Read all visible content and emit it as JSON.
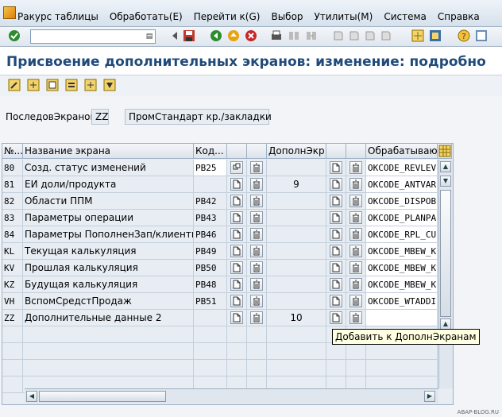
{
  "menu": {
    "items": [
      "Ракурс таблицы",
      "Обработать(E)",
      "Перейти к(G)",
      "Выбор",
      "Утилиты(M)",
      "Система",
      "Справка"
    ]
  },
  "title": "Присвоение дополнительных экранов: изменение: подробно",
  "sequence": {
    "label": "ПоследовЭкранов",
    "value": "ZZ",
    "description": "ПромСтандарт кр./закладки"
  },
  "table": {
    "headers": {
      "no": "№...",
      "name": "Название экрана",
      "code": "Код...",
      "add_screen": "ДополнЭкр",
      "ok_code": "Обрабатывающ"
    },
    "rows": [
      {
        "no": "80",
        "name": "Созд. статус изменений",
        "code": "PB25",
        "add": "",
        "ok": "OKCODE_REVLEV"
      },
      {
        "no": "81",
        "name": "ЕИ доли/продукта",
        "code": "",
        "add": "9",
        "ok": "OKCODE_ANTVAR"
      },
      {
        "no": "82",
        "name": "Области ППМ",
        "code": "PB42",
        "add": "",
        "ok": "OKCODE_DISPOB"
      },
      {
        "no": "83",
        "name": "Параметры операции",
        "code": "PB43",
        "add": "",
        "ok": "OKCODE_PLANPA"
      },
      {
        "no": "84",
        "name": "Параметры ПополненЗап/клиенты",
        "code": "PB46",
        "add": "",
        "ok": "OKCODE_RPL_CU"
      },
      {
        "no": "KL",
        "name": "Текущая калькуляция",
        "code": "PB49",
        "add": "",
        "ok": "OKCODE_MBEW_K"
      },
      {
        "no": "KV",
        "name": "Прошлая калькуляция",
        "code": "PB50",
        "add": "",
        "ok": "OKCODE_MBEW_K"
      },
      {
        "no": "KZ",
        "name": "Будущая калькуляция",
        "code": "PB48",
        "add": "",
        "ok": "OKCODE_MBEW_K"
      },
      {
        "no": "VH",
        "name": "ВспомСредстПродаж",
        "code": "PB51",
        "add": "",
        "ok": "OKCODE_WTADDI"
      },
      {
        "no": "ZZ",
        "name": "Дополнительные данные 2",
        "code": "",
        "add": "10",
        "ok": ""
      }
    ]
  },
  "tooltip": "Добавить к ДополнЭкранам",
  "watermark": "ABAP-BLOG.RU",
  "colors": {
    "title": "#1f4a7a",
    "grid_bg": "#e7edf3",
    "tooltip_bg": "#ffffe1"
  }
}
